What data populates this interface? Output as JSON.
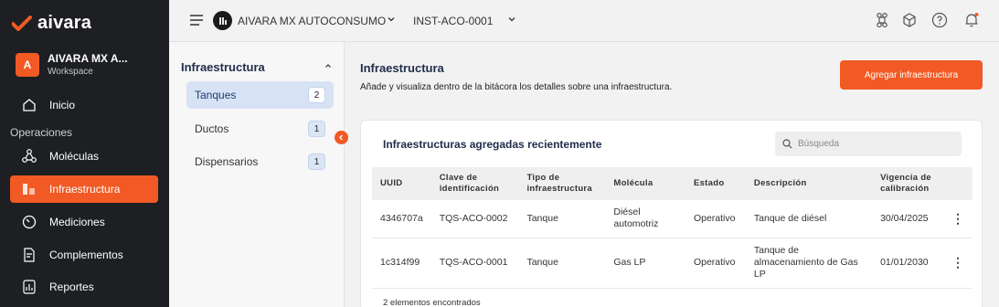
{
  "brand": {
    "name": "aivara",
    "accent": "#f15a24",
    "sidebar_bg": "#1d1f22"
  },
  "workspace": {
    "avatar": "A",
    "name": "AIVARA MX A...",
    "subtitle": "Workspace"
  },
  "nav": {
    "inicio": "Inicio",
    "section_operaciones": "Operaciones",
    "moleculas": "Moléculas",
    "infraestructura": "Infraestructura",
    "mediciones": "Mediciones",
    "complementos": "Complementos",
    "reportes": "Reportes"
  },
  "topbar": {
    "org": "AIVARA MX AUTOCONSUMO",
    "installation": "INST-ACO-0001",
    "icons": [
      "command-icon",
      "cube-icon",
      "help-icon",
      "bell-icon"
    ]
  },
  "subnav": {
    "title": "Infraestructura",
    "items": [
      {
        "label": "Tanques",
        "count": "2"
      },
      {
        "label": "Ductos",
        "count": "1"
      },
      {
        "label": "Dispensarios",
        "count": "1"
      }
    ]
  },
  "main": {
    "title": "Infraestructura",
    "description": "Añade y visualiza dentro de la bitácora los detalles sobre una infraestructura.",
    "add_button": "Agregar infraestructura"
  },
  "card": {
    "title": "Infraestructuras agregadas recientemente",
    "search_placeholder": "Búsqueda",
    "columns": [
      "UUID",
      "Clave de identificación",
      "Tipo de infraestructura",
      "Molécula",
      "Estado",
      "Descripción",
      "Vigencia de calibración"
    ],
    "rows": [
      {
        "uuid": "4346707a",
        "clave": "TQS-ACO-0002",
        "tipo": "Tanque",
        "molecula": "Diésel automotriz",
        "estado": "Operativo",
        "descripcion": "Tanque de diésel",
        "vigencia": "30/04/2025"
      },
      {
        "uuid": "1c314f99",
        "clave": "TQS-ACO-0001",
        "tipo": "Tanque",
        "molecula": "Gas LP",
        "estado": "Operativo",
        "descripcion": "Tanque de almacenamiento de Gas LP",
        "vigencia": "01/01/2030"
      }
    ],
    "footer": "2 elementos encontrados"
  }
}
